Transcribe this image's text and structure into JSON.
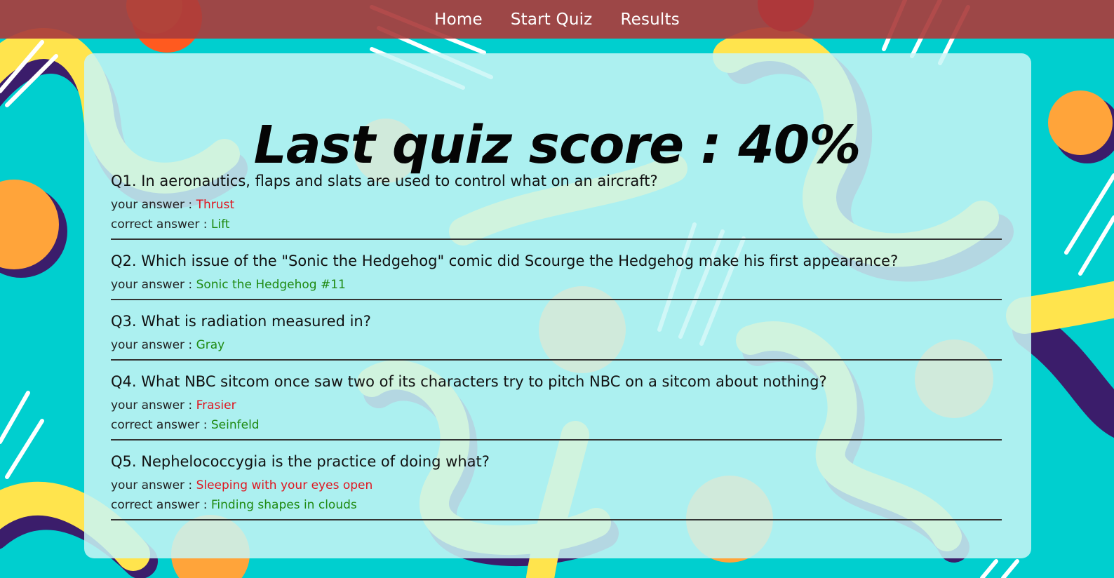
{
  "nav": {
    "items": [
      {
        "label": "Home"
      },
      {
        "label": "Start Quiz"
      },
      {
        "label": "Results"
      }
    ]
  },
  "score_title": "Last quiz score : 40%",
  "labels": {
    "your_answer": "your answer : ",
    "correct_answer": "correct answer : "
  },
  "questions": [
    {
      "text": "Q1. In aeronautics, flaps and slats are used to control what on an aircraft?",
      "your_answer": "Thrust",
      "correct_answer": "Lift"
    },
    {
      "text": "Q2. Which issue of the \"Sonic the Hedgehog\" comic did Scourge the Hedgehog make his first appearance?",
      "your_answer": "Sonic the Hedgehog #11"
    },
    {
      "text": "Q3. What is radiation measured in?",
      "your_answer": "Gray"
    },
    {
      "text": "Q4. What NBC sitcom once saw two of its characters try to pitch NBC on a sitcom about nothing?",
      "your_answer": "Frasier",
      "correct_answer": "Seinfeld"
    },
    {
      "text": "Q5. Nephelococcygia is the practice of doing what?",
      "your_answer": "Sleeping with your eyes open",
      "correct_answer": "Finding shapes in clouds"
    }
  ],
  "colors": {
    "background": "#00cfcf",
    "navbar": "#aa3c3c",
    "wrong": "#e0141e",
    "right": "#1f8a12"
  }
}
